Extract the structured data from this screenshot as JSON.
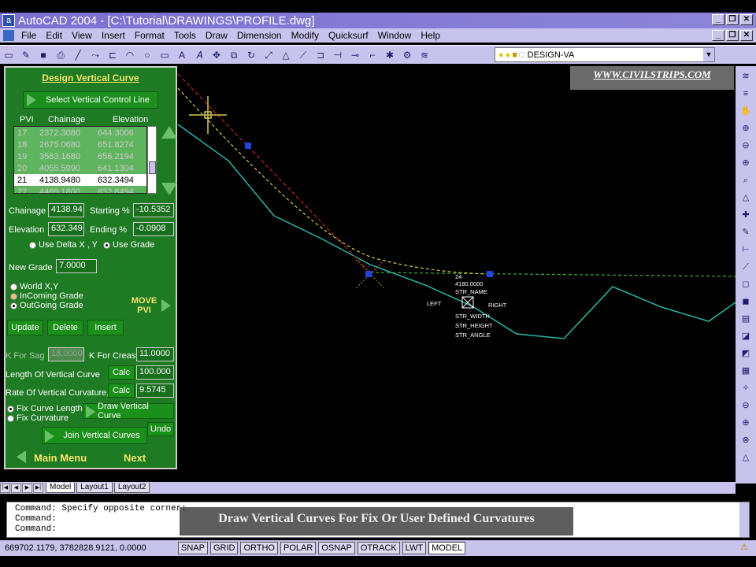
{
  "window": {
    "title": "AutoCAD 2004 - [C:\\Tutorial\\DRAWINGS\\PROFILE.dwg]",
    "app_icon_glyph": "a"
  },
  "menu": [
    "File",
    "Edit",
    "View",
    "Insert",
    "Format",
    "Tools",
    "Draw",
    "Dimension",
    "Modify",
    "Quicksurf",
    "Window",
    "Help"
  ],
  "layer": {
    "name": "DESIGN-VA"
  },
  "watermark": "WWW.CIVILSTRIPS.COM",
  "panel": {
    "title": "Design Vertical Curve",
    "select_control_line": "Select Vertical Control Line",
    "list_headers": [
      "PVI",
      "Chainage",
      "Elevation"
    ],
    "rows": [
      {
        "pvi": "17",
        "chainage": "2372.3080",
        "elevation": "644.3006"
      },
      {
        "pvi": "18",
        "chainage": "2675.0680",
        "elevation": "651.8274"
      },
      {
        "pvi": "19",
        "chainage": "3563.1680",
        "elevation": "656.2194"
      },
      {
        "pvi": "20",
        "chainage": "4055.5990",
        "elevation": "641.1304"
      },
      {
        "pvi": "21",
        "chainage": "4138.9480",
        "elevation": "632.3494"
      },
      {
        "pvi": "22",
        "chainage": "4469.1800",
        "elevation": "632.8494"
      }
    ],
    "selected_row": 4,
    "chainage_label": "Chainage",
    "chainage_value": "4138.94",
    "starting_label": "Starting %",
    "starting_value": "-10.5352",
    "elevation_label": "Elevation",
    "elevation_value": "632.349",
    "ending_label": "Ending %",
    "ending_value": "-0.0908",
    "use_delta_label": "Use Delta X , Y",
    "use_grade_label": "Use Grade",
    "new_grade_label": "New Grade",
    "new_grade_value": "7.0000",
    "world_xy": "World X,Y",
    "incoming_grade": "InComing Grade",
    "outgoing_grade": "OutGoing Grade",
    "move_pvi": "MOVE PVI",
    "update": "Update",
    "delete": "Delete",
    "insert": "Insert",
    "k_sag_label": "K For Sag",
    "k_sag_value": "18.0000",
    "k_crest_label": "K For Creast",
    "k_crest_value": "11.0000",
    "length_label": "Length Of Vertical Curve",
    "length_value": "100.000",
    "rate_label": "Rate Of Vertical Curvature,K",
    "rate_value": "9.5745",
    "calc": "Calc",
    "fix_length": "Fix Curve Length",
    "fix_curvature": "Fix Curvature",
    "draw_curve": "Draw Vertical Curve",
    "join_curves": "Join Vertical Curves",
    "undo": "Undo",
    "main_menu": "Main Menu",
    "next": "Next"
  },
  "drawing": {
    "pvi_label": "24",
    "chainage_text": "4180.0000",
    "str_name": "STR_NAME",
    "left": "LEFT",
    "right": "RIGHT",
    "str_width": "STR_WIDTH",
    "str_height": "STR_HEIGHT",
    "str_angle": "STR_ANGLE"
  },
  "tabs": [
    "Model",
    "Layout1",
    "Layout2"
  ],
  "command": {
    "lines": [
      "Command: Specify opposite corner:",
      "Command:",
      "Command:"
    ]
  },
  "caption": "Draw Vertical Curves For Fix Or User Defined Curvatures",
  "status": {
    "coords": "669702.1179, 3782828.9121, 0.0000",
    "toggles": [
      "SNAP",
      "GRID",
      "ORTHO",
      "POLAR",
      "OSNAP",
      "OTRACK",
      "LWT",
      "MODEL"
    ]
  },
  "colors": {
    "panel_bg": "#1e7a23",
    "title_yellow": "#f4e56c",
    "profile_cyan": "#2bb5a8",
    "grade_green": "#3fae3f",
    "curve_yellow": "#d6c94a",
    "tangent_red": "#b3261e",
    "grip_blue": "#2244dd"
  }
}
